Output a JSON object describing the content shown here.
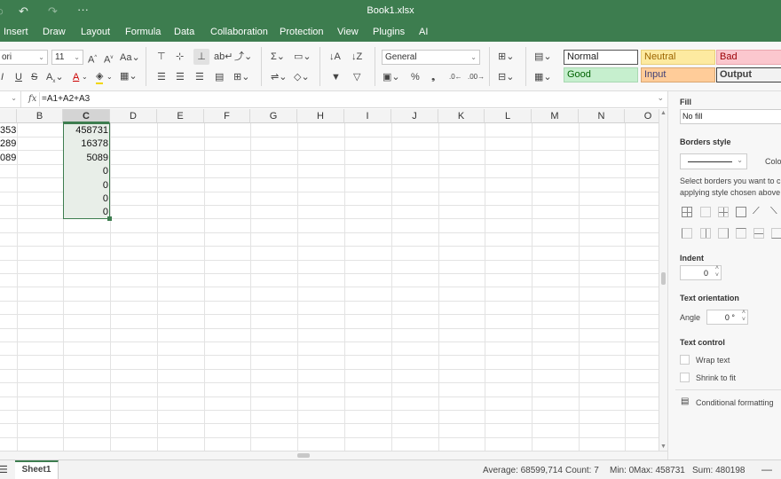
{
  "app": {
    "title": "Book1.xlsx"
  },
  "menu": [
    "Insert",
    "Draw",
    "Layout",
    "Formula",
    "Data",
    "Collaboration",
    "Protection",
    "View",
    "Plugins",
    "AI"
  ],
  "toolbar": {
    "font_name": "ori",
    "font_size": "11",
    "number_format": "General",
    "styles": {
      "normal": "Normal",
      "neutral": "Neutral",
      "bad": "Bad",
      "good": "Good",
      "input": "Input",
      "output": "Output"
    }
  },
  "formula": {
    "cell_ref": "",
    "fx": "fx",
    "content": "=A1+A2+A3"
  },
  "sheet": {
    "columns": [
      "B",
      "C",
      "D",
      "E",
      "F",
      "G",
      "H",
      "I",
      "J",
      "K",
      "L",
      "M",
      "N",
      "O"
    ],
    "col_a_values": [
      "353",
      "289",
      "089"
    ],
    "col_c_values": [
      "458731",
      "16378",
      "5089",
      "0",
      "0",
      "0",
      "0"
    ]
  },
  "panel": {
    "fill_label": "Fill",
    "fill_value": "No fill",
    "borders_label": "Borders style",
    "color_label": "Colo",
    "borders_hint_1": "Select borders you want to c",
    "borders_hint_2": "applying style chosen above",
    "indent_label": "Indent",
    "indent_value": "0",
    "orientation_label": "Text orientation",
    "angle_label": "Angle",
    "angle_value": "0 °",
    "control_label": "Text control",
    "wrap_text": "Wrap text",
    "shrink_to_fit": "Shrink to fit",
    "conditional": "Conditional formatting"
  },
  "status": {
    "sheet_tab": "Sheet1",
    "average": "Average: 68599,714",
    "count": "Count: 7",
    "min": "Min: 0",
    "max": "Max: 458731",
    "sum": "Sum: 480198"
  }
}
